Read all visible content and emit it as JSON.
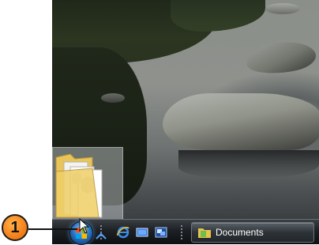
{
  "taskbar": {
    "window_buttons": [
      {
        "label": "Documents",
        "icon": "folder-icon"
      }
    ],
    "quick_launch": [
      "show-desktop-icon",
      "internet-explorer-icon",
      "switch-windows-icon",
      "media-icon"
    ]
  },
  "callout": {
    "number": "1"
  },
  "colors": {
    "callout": "#f5841f",
    "taskbar": "#1c2024"
  }
}
